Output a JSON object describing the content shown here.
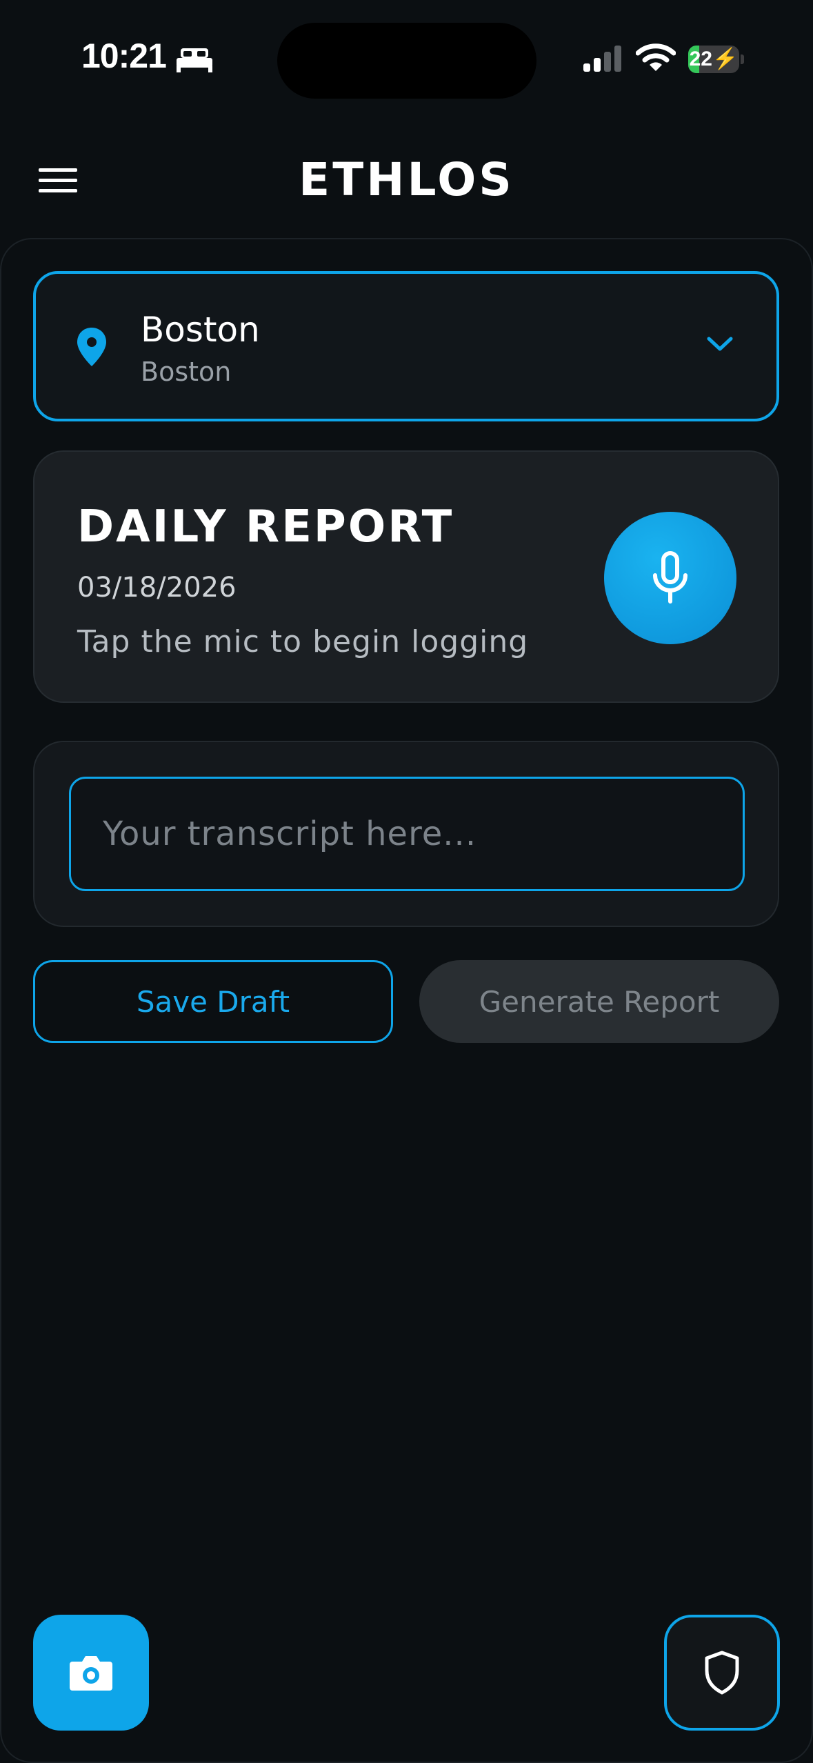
{
  "status_bar": {
    "time": "10:21",
    "battery_percent": 22,
    "battery_label": "22",
    "icons": [
      "bed-icon",
      "signal-icon",
      "wifi-icon",
      "battery-charging-icon"
    ]
  },
  "header": {
    "title": "ETHLOS",
    "menu_icon": "hamburger-menu-icon"
  },
  "location": {
    "name": "Boston",
    "subtitle": "Boston",
    "icon": "map-pin-icon",
    "dropdown_icon": "chevron-down-icon"
  },
  "daily_report": {
    "title": "DAILY REPORT",
    "date": "03/18/2026",
    "hint": "Tap the mic to begin logging",
    "mic_icon": "microphone-icon"
  },
  "transcript": {
    "value": "",
    "placeholder": "Your transcript here..."
  },
  "actions": {
    "save_label": "Save Draft",
    "generate_label": "Generate Report"
  },
  "bottom": {
    "camera_icon": "camera-icon",
    "shield_icon": "shield-icon"
  },
  "colors": {
    "accent": "#0ea5e9",
    "background": "#0b0f12",
    "card": "#1b1f23",
    "disabled_button": "#292e32"
  }
}
